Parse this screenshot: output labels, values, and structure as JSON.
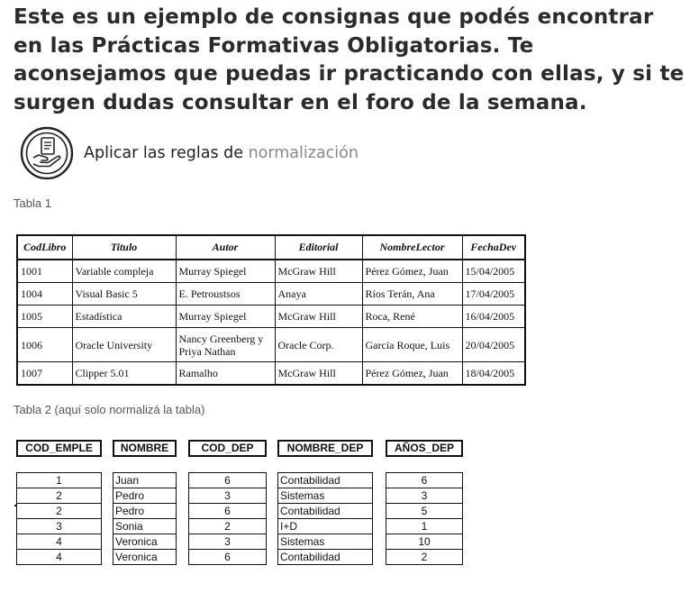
{
  "intro_text": "Este es un ejemplo de consignas que podés encontrar en las Prácticas Formativas Obligatorias. Te aconsejamos que puedas ir practicando con ellas, y si te surgen dudas consultar en el foro de la semana.",
  "task": {
    "icon": "hand-holding-document-icon",
    "title_prefix": "Aplicar las reglas de",
    "title_highlight": "normalización"
  },
  "table1": {
    "caption": "Tabla 1",
    "headers": [
      "CodLibro",
      "Titulo",
      "Autor",
      "Editorial",
      "NombreLector",
      "FechaDev"
    ],
    "rows": [
      [
        "1001",
        "Variable compleja",
        "Murray Spiegel",
        "McGraw Hill",
        "Pérez Gómez, Juan",
        "15/04/2005"
      ],
      [
        "1004",
        "Visual Basic 5",
        "E. Petroustsos",
        "Anaya",
        "Ríos Terán, Ana",
        "17/04/2005"
      ],
      [
        "1005",
        "Estadística",
        "Murray Spiegel",
        "McGraw Hill",
        "Roca, René",
        "16/04/2005"
      ],
      [
        "1006",
        "Oracle University",
        "Nancy Greenberg y Priya Nathan",
        "Oracle Corp.",
        "García Roque, Luis",
        "20/04/2005"
      ],
      [
        "1007",
        "Clipper 5.01",
        "Ramalho",
        "McGraw Hill",
        "Pérez Gómez, Juan",
        "18/04/2005"
      ]
    ]
  },
  "table2": {
    "caption": "Tabla 2 (aquí solo normalizá la tabla)",
    "columns": [
      {
        "header": "COD_EMPLE",
        "values": [
          "1",
          "2",
          "2",
          "3",
          "4",
          "4"
        ]
      },
      {
        "header": "NOMBRE",
        "values": [
          "Juan",
          "Pedro",
          "Pedro",
          "Sonia",
          "Veronica",
          "Veronica"
        ]
      },
      {
        "header": "COD_DEP",
        "values": [
          "6",
          "3",
          "6",
          "2",
          "3",
          "6"
        ]
      },
      {
        "header": "NOMBRE_DEP",
        "values": [
          "Contabilidad",
          "Sistemas",
          "Contabilidad",
          "I+D",
          "Sistemas",
          "Contabilidad"
        ]
      },
      {
        "header": "AÑOS_DEP",
        "values": [
          "6",
          "3",
          "5",
          "1",
          "10",
          "2"
        ]
      }
    ]
  }
}
